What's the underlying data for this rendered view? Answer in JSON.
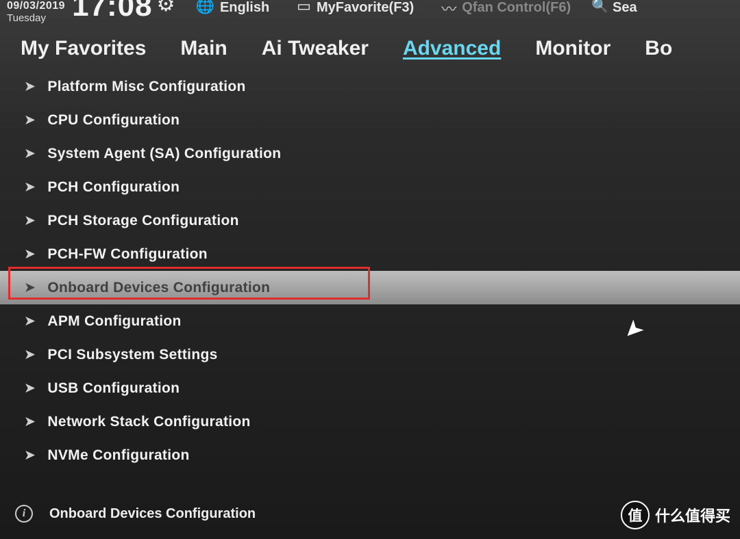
{
  "header": {
    "date": "09/03/2019",
    "day": "Tuesday",
    "time": "17:08",
    "language": "English",
    "favorite": "MyFavorite(F3)",
    "qfan": "Qfan Control(F6)",
    "search": "Sea"
  },
  "tabs": {
    "t0": "My Favorites",
    "t1": "Main",
    "t2": "Ai Tweaker",
    "t3": "Advanced",
    "t4": "Monitor",
    "t5": "Bo"
  },
  "menu": {
    "m0": "Platform Misc Configuration",
    "m1": "CPU Configuration",
    "m2": "System Agent (SA) Configuration",
    "m3": "PCH Configuration",
    "m4": "PCH Storage Configuration",
    "m5": "PCH-FW Configuration",
    "m6": "Onboard Devices Configuration",
    "m7": "APM Configuration",
    "m8": "PCI Subsystem Settings",
    "m9": "USB Configuration",
    "m10": "Network Stack Configuration",
    "m11": "NVMe Configuration"
  },
  "help": {
    "text": "Onboard Devices Configuration"
  },
  "watermark": {
    "badge": "值",
    "text": "什么值得买"
  }
}
